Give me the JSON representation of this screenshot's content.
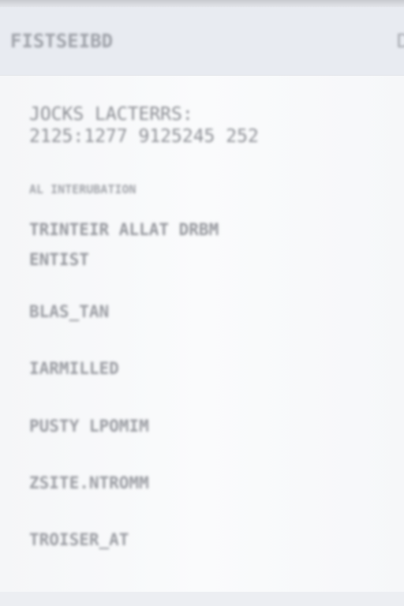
{
  "header": {
    "title": "FISTSEIBD",
    "edge_glyph": "D"
  },
  "info": {
    "title": "JOCKS LACTERRS:",
    "number": "2125:1277 9125245 252"
  },
  "section": {
    "label": "AL INTERUBATION",
    "field_title": "TRINTEIR ALLAT DRBM",
    "field_sub": "ENTIST"
  },
  "items": [
    {
      "label": "BLAS_TAN"
    },
    {
      "label": "IARMILLED"
    },
    {
      "label": "PUSTY LPOMIM"
    },
    {
      "label": "ZSITE.NTROMM"
    },
    {
      "label": "TROISER_AT"
    }
  ]
}
